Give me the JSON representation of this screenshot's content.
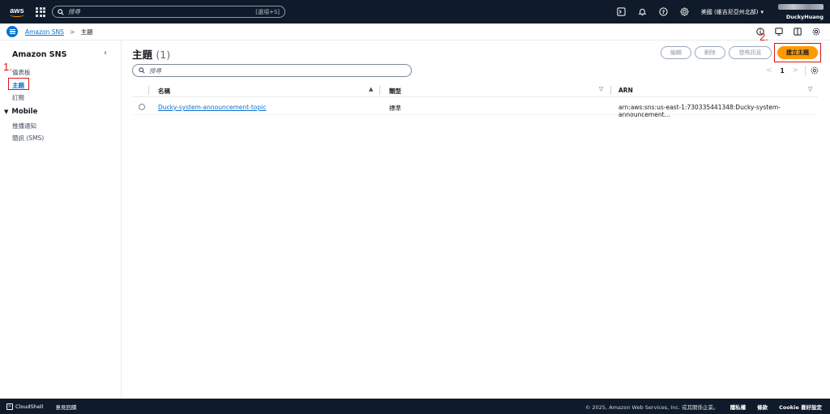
{
  "topbar": {
    "logo_text": "aws",
    "search_placeholder": "搜尋",
    "search_hint": "[選項+S]",
    "region": "美國 (維吉尼亞州北部)",
    "account_name": "DuckyHuang",
    "icons": [
      "apps-grid-icon",
      "search-icon",
      "cloudshell-icon",
      "bell-icon",
      "help-icon",
      "gear-icon",
      "caret-down-icon"
    ]
  },
  "breadcrumb": {
    "service": "Amazon SNS",
    "separator": ">",
    "current": "主題"
  },
  "sidebar": {
    "title": "Amazon SNS",
    "items": [
      {
        "label": "儀表板",
        "active": false
      },
      {
        "label": "主題",
        "active": true
      },
      {
        "label": "訂閱",
        "active": false
      }
    ],
    "section_title": "Mobile",
    "section_items": [
      {
        "label": "推播通知"
      },
      {
        "label": "簡訊 (SMS)"
      }
    ]
  },
  "annotations": {
    "step1": "1.",
    "step2": "2."
  },
  "main": {
    "title": "主題",
    "count": "(1)",
    "buttons": {
      "edit": "編輯",
      "delete": "刪除",
      "publish": "發佈訊息",
      "create": "建立主題"
    },
    "search_placeholder": "搜尋",
    "pagination": {
      "prev": "<",
      "page": "1",
      "next": ">"
    },
    "table": {
      "columns": [
        "名稱",
        "類型",
        "ARN"
      ],
      "rows": [
        {
          "name": "Ducky-system-announcement-topic",
          "type": "標準",
          "arn": "arn:aws:sns:us-east-1:730335441348:Ducky-system-announcement..."
        }
      ]
    }
  },
  "footer": {
    "cloudshell": "CloudShell",
    "feedback": "意見回饋",
    "copyright": "© 2025, Amazon Web Services, Inc. 或其關係企業。",
    "privacy": "隱私權",
    "terms": "條款",
    "cookies": "Cookie 喜好設定"
  },
  "colors": {
    "nav_bg": "#0f1b2a",
    "link": "#0972d3",
    "primary": "#ff9900",
    "annotation": "#d91515"
  }
}
